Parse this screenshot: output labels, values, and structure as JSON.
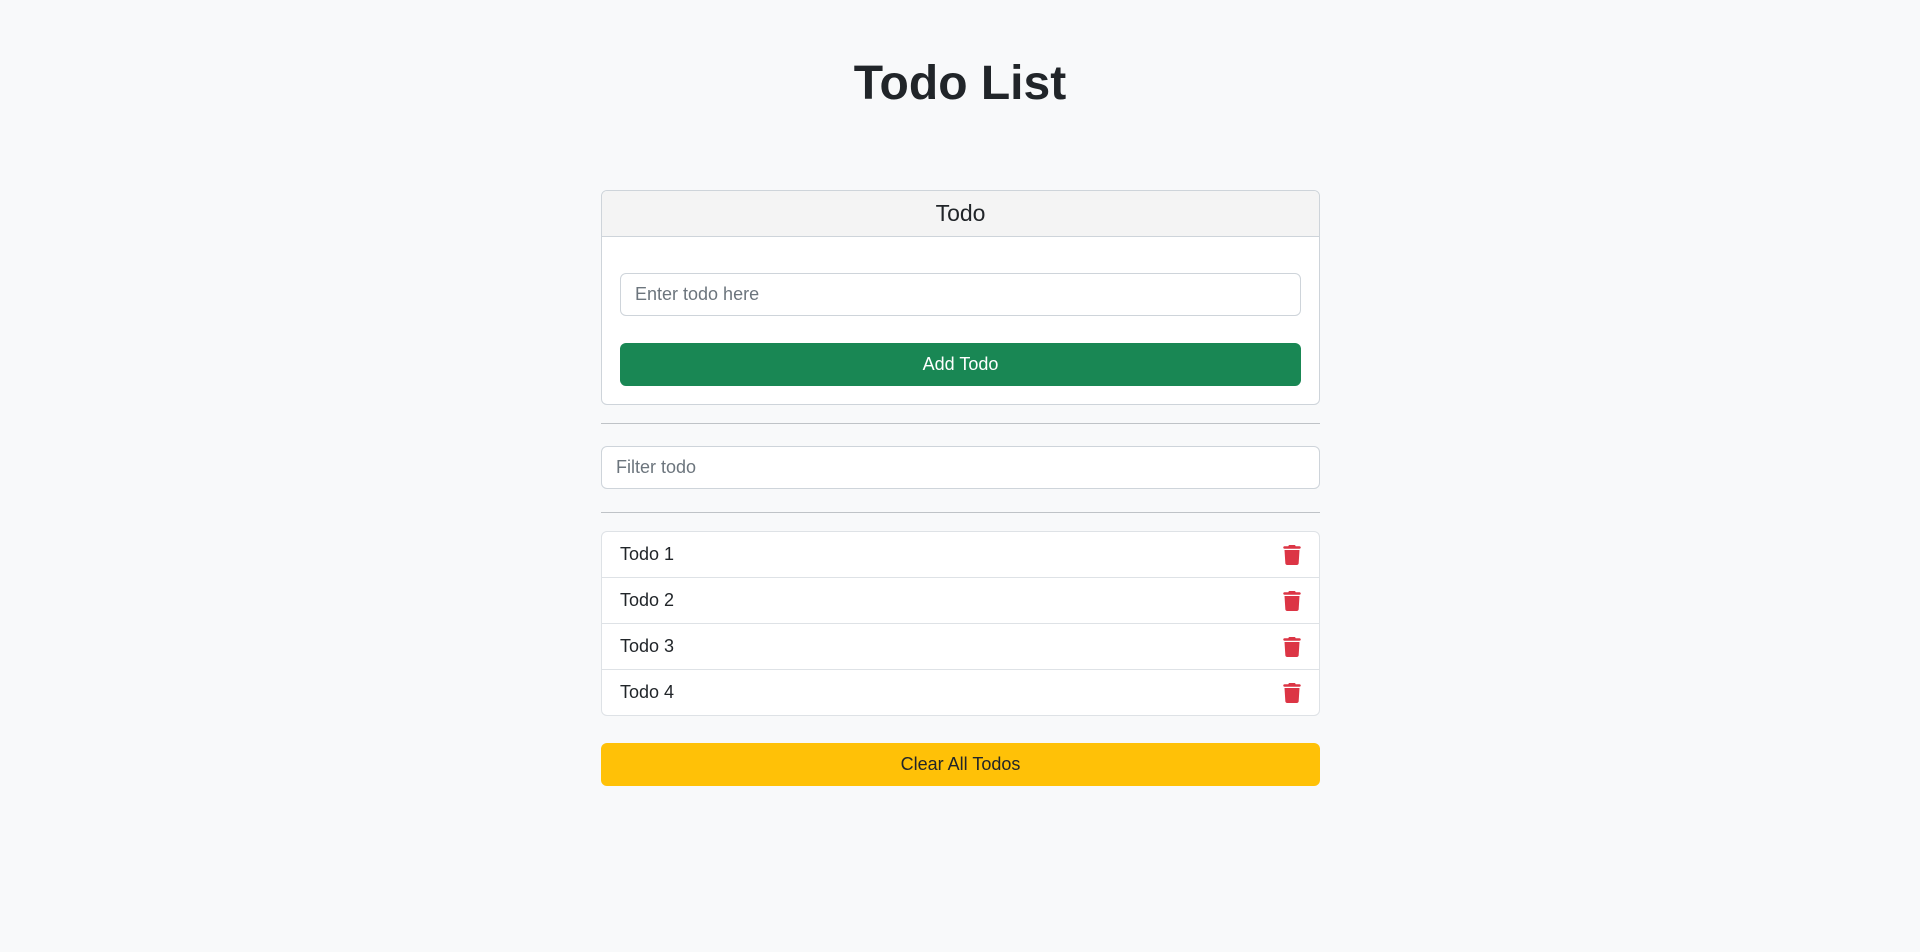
{
  "page": {
    "title": "Todo List"
  },
  "todo_card": {
    "header": "Todo",
    "input_placeholder": "Enter todo here",
    "input_value": "",
    "add_button_label": "Add Todo"
  },
  "filter": {
    "placeholder": "Filter todo",
    "value": ""
  },
  "todos": [
    {
      "label": "Todo 1",
      "icon": "trash-icon"
    },
    {
      "label": "Todo 2",
      "icon": "trash-icon"
    },
    {
      "label": "Todo 3",
      "icon": "trash-icon"
    },
    {
      "label": "Todo 4",
      "icon": "trash-icon"
    }
  ],
  "clear_button_label": "Clear All Todos",
  "colors": {
    "background": "#f8f9fa",
    "add_button": "#198754",
    "clear_button": "#ffc107",
    "delete_icon": "#dc3545"
  }
}
